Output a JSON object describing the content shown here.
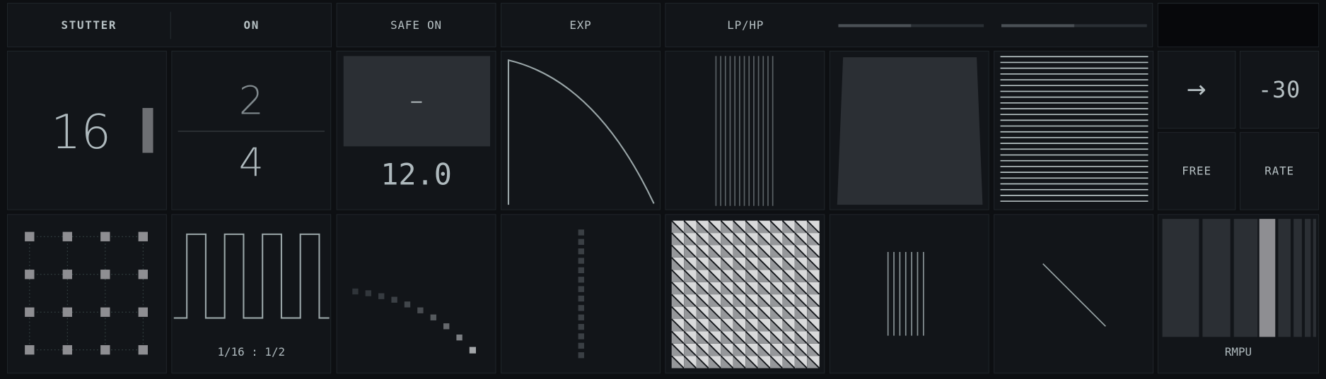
{
  "top_bar": {
    "stutter_label": "STUTTER",
    "on_label": "ON",
    "safe_label": "SAFE ON",
    "curve_label": "EXP",
    "filter_label": "LP/HP",
    "filter_slider_1": 0.5,
    "filter_slider_2": 0.5
  },
  "row1": {
    "steps_value": "16",
    "time_sig_numerator": "2",
    "time_sig_denominator": "4",
    "gain_symbol": "—",
    "gain_value": "12.0",
    "direction_symbol": "→",
    "offset_value": "-30",
    "free_label": "FREE",
    "rate_label": "RATE"
  },
  "row2": {
    "ratio_label": "1/16 : 1/2",
    "meter_label": "RMPU"
  },
  "colors": {
    "background": "#0d0f12",
    "panel": "#121519",
    "border": "#23292e",
    "accent": "#9fb8b6",
    "gray_fill": "#8e8e92"
  }
}
